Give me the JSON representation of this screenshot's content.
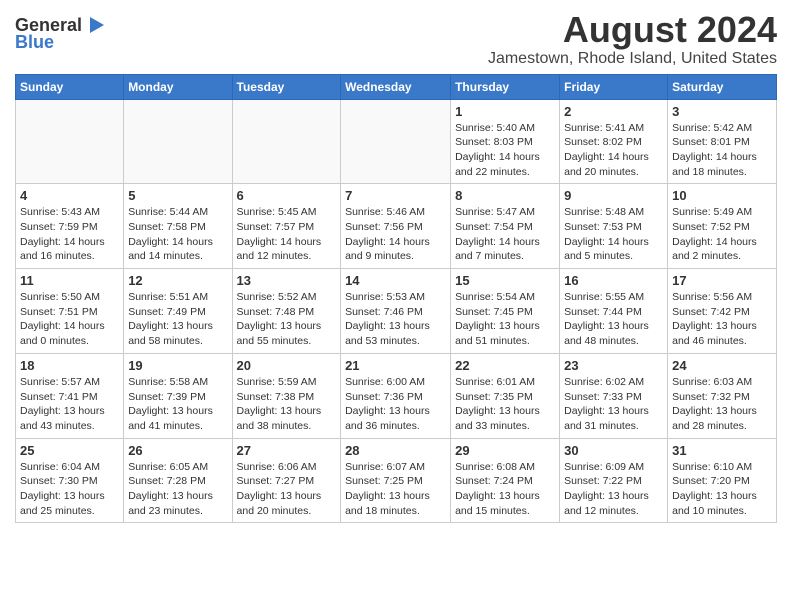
{
  "logo": {
    "general": "General",
    "blue": "Blue"
  },
  "title": "August 2024",
  "subtitle": "Jamestown, Rhode Island, United States",
  "days_of_week": [
    "Sunday",
    "Monday",
    "Tuesday",
    "Wednesday",
    "Thursday",
    "Friday",
    "Saturday"
  ],
  "weeks": [
    [
      {
        "day": "",
        "info": ""
      },
      {
        "day": "",
        "info": ""
      },
      {
        "day": "",
        "info": ""
      },
      {
        "day": "",
        "info": ""
      },
      {
        "day": "1",
        "info": "Sunrise: 5:40 AM\nSunset: 8:03 PM\nDaylight: 14 hours and 22 minutes."
      },
      {
        "day": "2",
        "info": "Sunrise: 5:41 AM\nSunset: 8:02 PM\nDaylight: 14 hours and 20 minutes."
      },
      {
        "day": "3",
        "info": "Sunrise: 5:42 AM\nSunset: 8:01 PM\nDaylight: 14 hours and 18 minutes."
      }
    ],
    [
      {
        "day": "4",
        "info": "Sunrise: 5:43 AM\nSunset: 7:59 PM\nDaylight: 14 hours and 16 minutes."
      },
      {
        "day": "5",
        "info": "Sunrise: 5:44 AM\nSunset: 7:58 PM\nDaylight: 14 hours and 14 minutes."
      },
      {
        "day": "6",
        "info": "Sunrise: 5:45 AM\nSunset: 7:57 PM\nDaylight: 14 hours and 12 minutes."
      },
      {
        "day": "7",
        "info": "Sunrise: 5:46 AM\nSunset: 7:56 PM\nDaylight: 14 hours and 9 minutes."
      },
      {
        "day": "8",
        "info": "Sunrise: 5:47 AM\nSunset: 7:54 PM\nDaylight: 14 hours and 7 minutes."
      },
      {
        "day": "9",
        "info": "Sunrise: 5:48 AM\nSunset: 7:53 PM\nDaylight: 14 hours and 5 minutes."
      },
      {
        "day": "10",
        "info": "Sunrise: 5:49 AM\nSunset: 7:52 PM\nDaylight: 14 hours and 2 minutes."
      }
    ],
    [
      {
        "day": "11",
        "info": "Sunrise: 5:50 AM\nSunset: 7:51 PM\nDaylight: 14 hours and 0 minutes."
      },
      {
        "day": "12",
        "info": "Sunrise: 5:51 AM\nSunset: 7:49 PM\nDaylight: 13 hours and 58 minutes."
      },
      {
        "day": "13",
        "info": "Sunrise: 5:52 AM\nSunset: 7:48 PM\nDaylight: 13 hours and 55 minutes."
      },
      {
        "day": "14",
        "info": "Sunrise: 5:53 AM\nSunset: 7:46 PM\nDaylight: 13 hours and 53 minutes."
      },
      {
        "day": "15",
        "info": "Sunrise: 5:54 AM\nSunset: 7:45 PM\nDaylight: 13 hours and 51 minutes."
      },
      {
        "day": "16",
        "info": "Sunrise: 5:55 AM\nSunset: 7:44 PM\nDaylight: 13 hours and 48 minutes."
      },
      {
        "day": "17",
        "info": "Sunrise: 5:56 AM\nSunset: 7:42 PM\nDaylight: 13 hours and 46 minutes."
      }
    ],
    [
      {
        "day": "18",
        "info": "Sunrise: 5:57 AM\nSunset: 7:41 PM\nDaylight: 13 hours and 43 minutes."
      },
      {
        "day": "19",
        "info": "Sunrise: 5:58 AM\nSunset: 7:39 PM\nDaylight: 13 hours and 41 minutes."
      },
      {
        "day": "20",
        "info": "Sunrise: 5:59 AM\nSunset: 7:38 PM\nDaylight: 13 hours and 38 minutes."
      },
      {
        "day": "21",
        "info": "Sunrise: 6:00 AM\nSunset: 7:36 PM\nDaylight: 13 hours and 36 minutes."
      },
      {
        "day": "22",
        "info": "Sunrise: 6:01 AM\nSunset: 7:35 PM\nDaylight: 13 hours and 33 minutes."
      },
      {
        "day": "23",
        "info": "Sunrise: 6:02 AM\nSunset: 7:33 PM\nDaylight: 13 hours and 31 minutes."
      },
      {
        "day": "24",
        "info": "Sunrise: 6:03 AM\nSunset: 7:32 PM\nDaylight: 13 hours and 28 minutes."
      }
    ],
    [
      {
        "day": "25",
        "info": "Sunrise: 6:04 AM\nSunset: 7:30 PM\nDaylight: 13 hours and 25 minutes."
      },
      {
        "day": "26",
        "info": "Sunrise: 6:05 AM\nSunset: 7:28 PM\nDaylight: 13 hours and 23 minutes."
      },
      {
        "day": "27",
        "info": "Sunrise: 6:06 AM\nSunset: 7:27 PM\nDaylight: 13 hours and 20 minutes."
      },
      {
        "day": "28",
        "info": "Sunrise: 6:07 AM\nSunset: 7:25 PM\nDaylight: 13 hours and 18 minutes."
      },
      {
        "day": "29",
        "info": "Sunrise: 6:08 AM\nSunset: 7:24 PM\nDaylight: 13 hours and 15 minutes."
      },
      {
        "day": "30",
        "info": "Sunrise: 6:09 AM\nSunset: 7:22 PM\nDaylight: 13 hours and 12 minutes."
      },
      {
        "day": "31",
        "info": "Sunrise: 6:10 AM\nSunset: 7:20 PM\nDaylight: 13 hours and 10 minutes."
      }
    ]
  ]
}
